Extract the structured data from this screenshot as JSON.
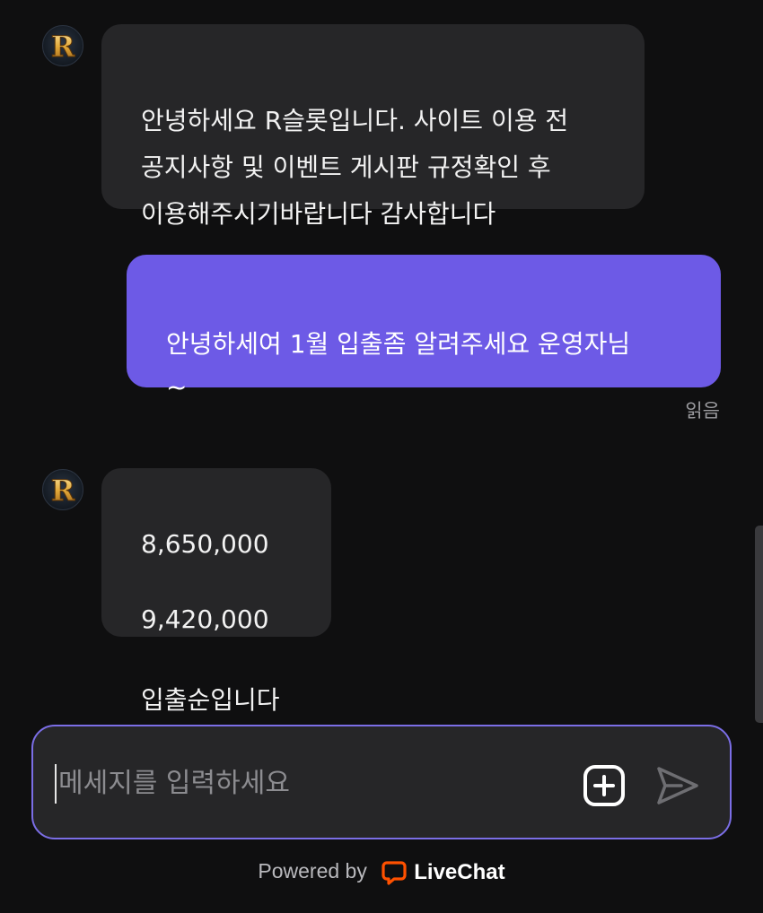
{
  "messages": [
    {
      "sender": "agent",
      "text": "안녕하세요 R슬롯입니다. 사이트 이용 전\n공지사항 및 이벤트 게시판 규정확인 후\n이용해주시기바랍니다 감사합니다"
    },
    {
      "sender": "visitor",
      "text": "안녕하세여 1월 입출좀 알려주세요 운영자님\n~"
    },
    {
      "sender": "agent",
      "lines": [
        "8,650,000",
        "9,420,000",
        "입출순입니다"
      ]
    }
  ],
  "read_status": "읽음",
  "avatar": {
    "letter": "R",
    "icon": "r-logo-avatar-icon"
  },
  "composer": {
    "placeholder": "메세지를 입력하세요",
    "attach_icon": "plus-square-icon",
    "send_icon": "send-arrow-icon"
  },
  "footer": {
    "prefix": "Powered by",
    "brand": "LiveChat",
    "brand_color": "#ff5100",
    "brand_icon": "livechat-logo-icon"
  },
  "colors": {
    "background": "#0f0f10",
    "agent_bubble": "#262628",
    "visitor_bubble": "#6d5ae6",
    "composer_border": "#7b6ee6"
  }
}
